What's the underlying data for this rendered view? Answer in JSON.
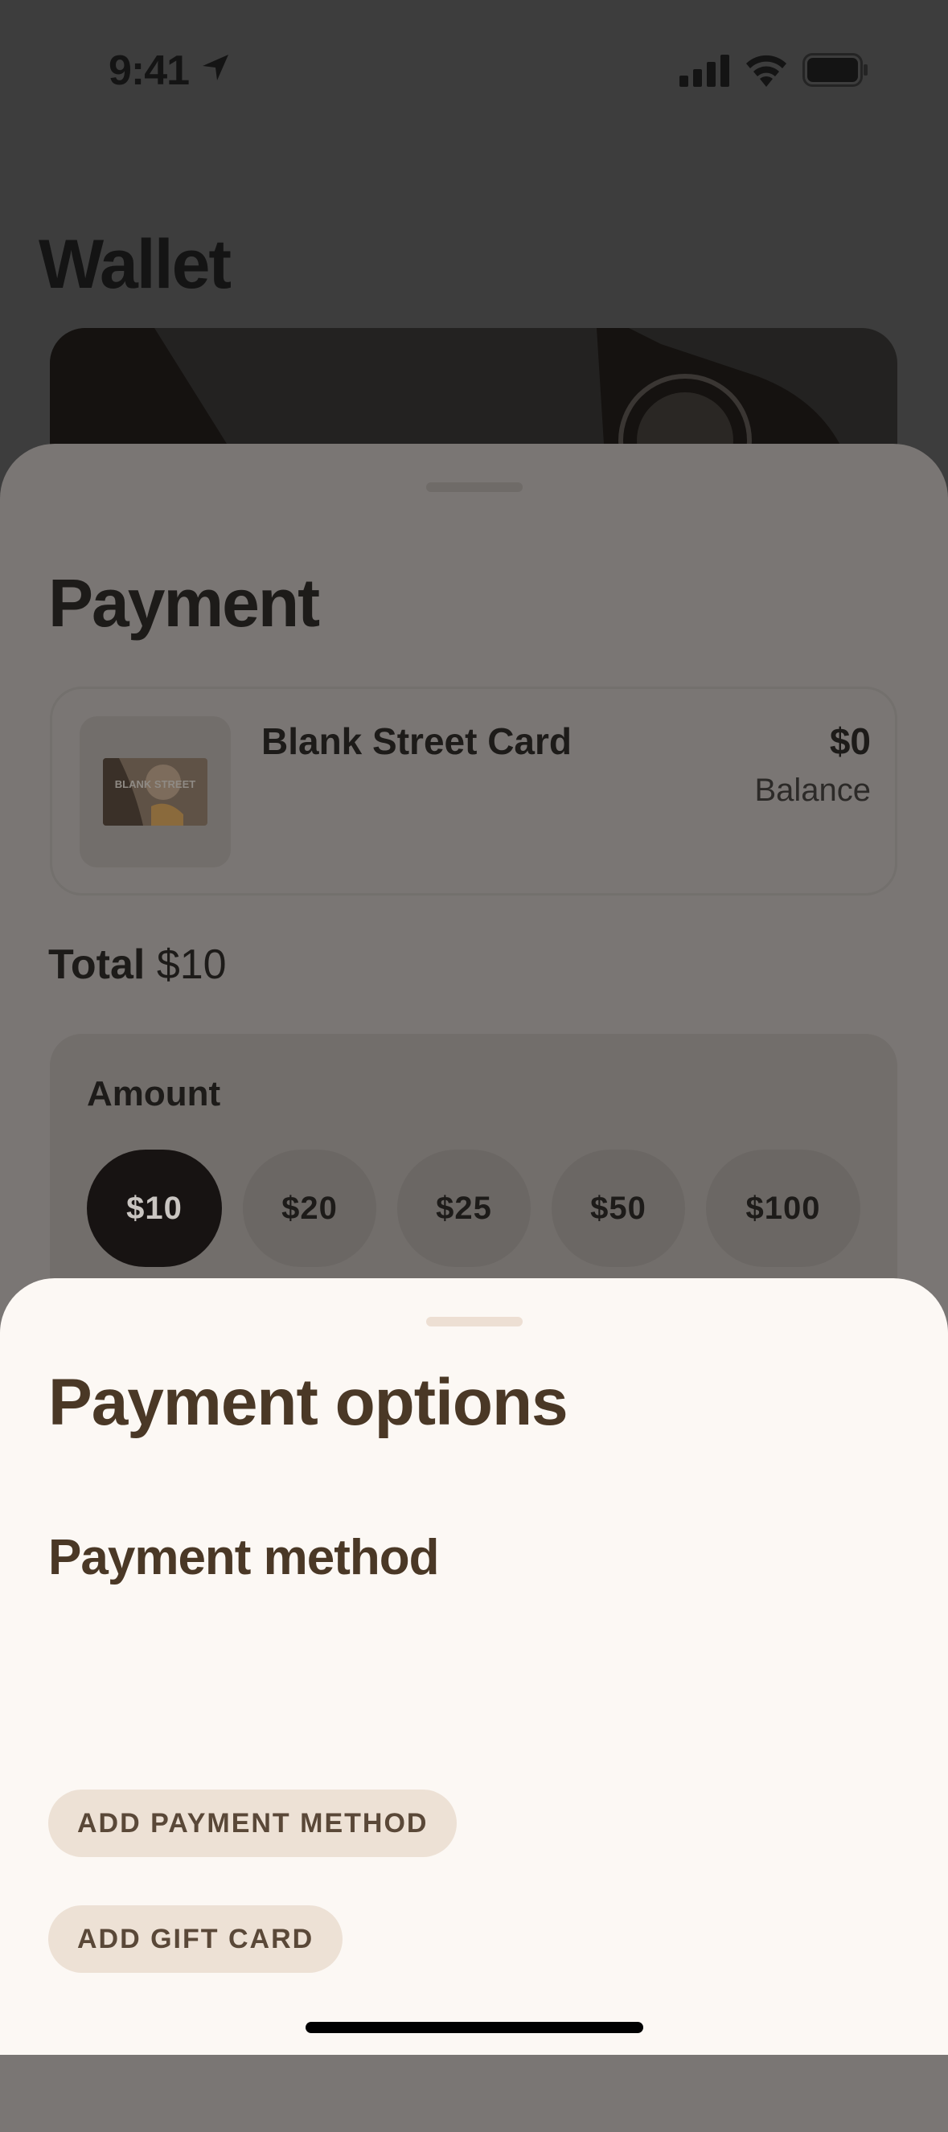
{
  "status_bar": {
    "time": "9:41",
    "icons": [
      "location-arrow-icon",
      "signal-bars-icon",
      "wifi-icon",
      "battery-icon"
    ]
  },
  "wallet": {
    "title": "Wallet"
  },
  "payment_sheet": {
    "title": "Payment",
    "card": {
      "name": "Blank Street Card",
      "thumbnail_text": "BLANK STREET",
      "amount": "$0",
      "balance_label": "Balance"
    },
    "total": {
      "label": "Total",
      "value": "$10"
    },
    "amount_section": {
      "label": "Amount",
      "options": [
        "$10",
        "$20",
        "$25",
        "$50",
        "$100"
      ],
      "selected": "$10"
    }
  },
  "options_sheet": {
    "title": "Payment options",
    "method_heading": "Payment method",
    "add_payment_method_label": "ADD PAYMENT METHOD",
    "add_gift_card_label": "ADD GIFT CARD"
  },
  "colors": {
    "accent_brown": "#4a3826",
    "pill_background": "#ede1d5",
    "sheet_background": "#fcf8f4",
    "selected_amount": "#171312"
  }
}
